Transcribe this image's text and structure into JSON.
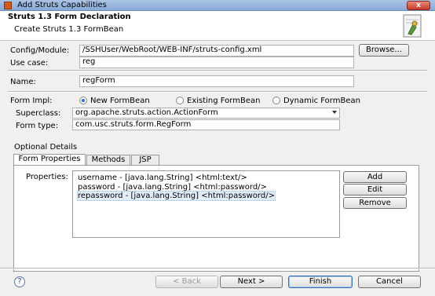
{
  "window": {
    "title": "Add Struts Capabilities",
    "close_label": "x"
  },
  "header": {
    "title": "Struts 1.3 Form Declaration",
    "subtitle": "Create Struts 1.3 FormBean"
  },
  "config": {
    "label": "Config/Module:",
    "value": "/SSHUser/WebRoot/WEB-INF/struts-config.xml",
    "browse_label": "Browse..."
  },
  "use_case": {
    "label": "Use case:",
    "value": "reg"
  },
  "name": {
    "label": "Name:",
    "value": "regForm"
  },
  "form_impl": {
    "label": "Form Impl:",
    "options": [
      "New FormBean",
      "Existing FormBean",
      "Dynamic FormBean"
    ],
    "selected": "New FormBean"
  },
  "superclass": {
    "label": "Superclass:",
    "value": "org.apache.struts.action.ActionForm"
  },
  "form_type": {
    "label": "Form type:",
    "value": "com.usc.struts.form.RegForm"
  },
  "optional": {
    "label": "Optional Details",
    "tabs": [
      "Form Properties",
      "Methods",
      "JSP"
    ],
    "active_tab": "Form Properties",
    "properties_label": "Properties:",
    "properties": [
      "username - [java.lang.String] <html:text/>",
      "password - [java.lang.String] <html:password/>",
      "repassword - [java.lang.String] <html:password/>"
    ],
    "buttons": {
      "add": "Add",
      "edit": "Edit",
      "remove": "Remove"
    }
  },
  "footer": {
    "help": "?",
    "back": "< Back",
    "next": "Next >",
    "finish": "Finish",
    "cancel": "Cancel"
  }
}
